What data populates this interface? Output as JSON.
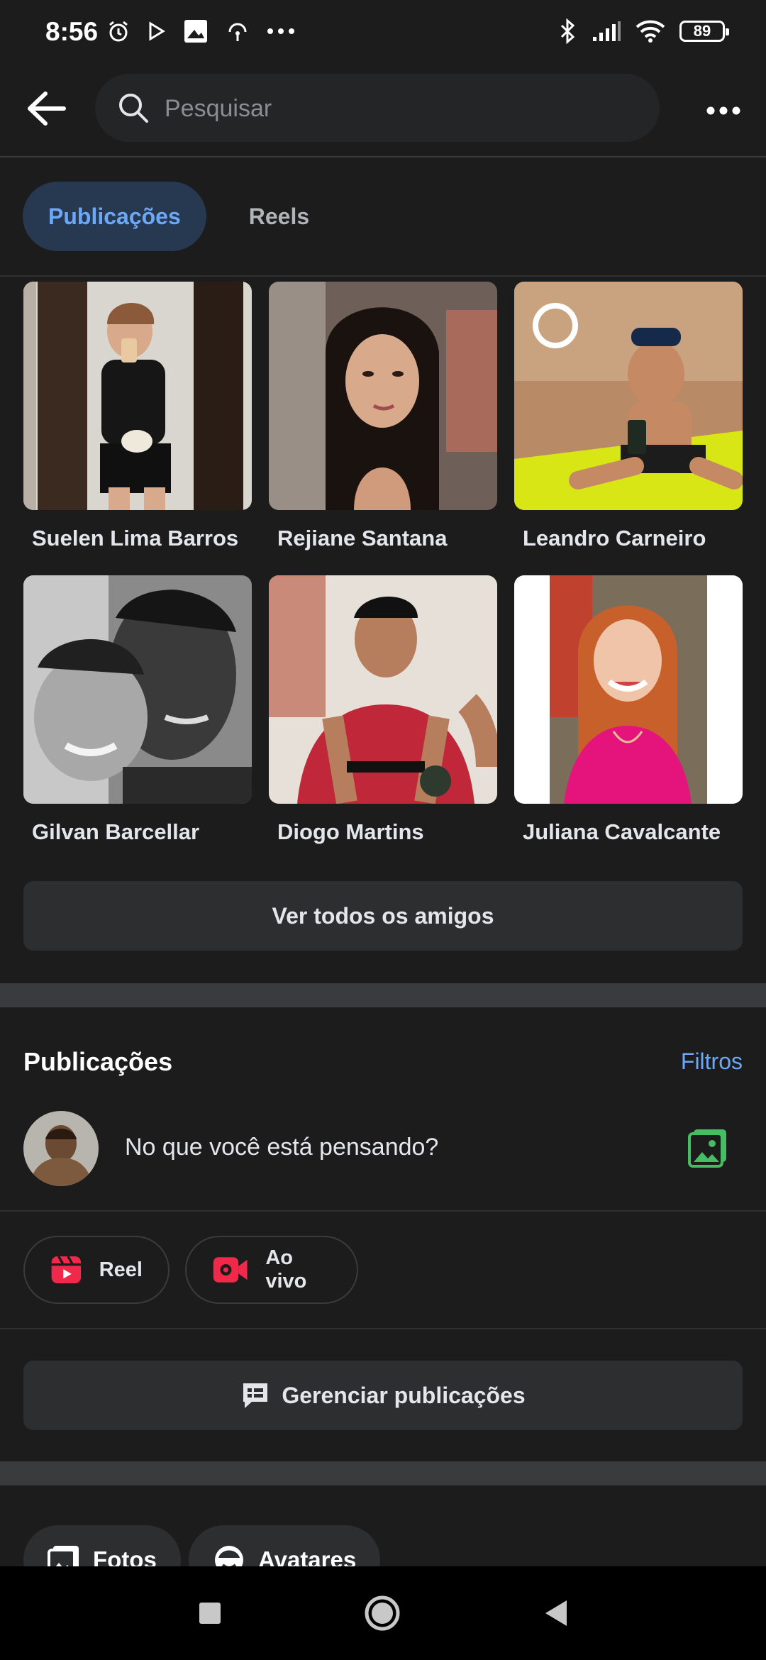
{
  "status_bar": {
    "time": "8:56",
    "battery": "89"
  },
  "search": {
    "placeholder": "Pesquisar"
  },
  "tabs": [
    {
      "label": "Publicações",
      "active": true
    },
    {
      "label": "Reels",
      "active": false
    }
  ],
  "friends": [
    {
      "name": "Suelen Lima Barros"
    },
    {
      "name": "Rejiane Santana"
    },
    {
      "name": "Leandro Carneiro"
    },
    {
      "name": "Gilvan Barcellar"
    },
    {
      "name": "Diogo Martins"
    },
    {
      "name": "Juliana Cavalcante"
    }
  ],
  "see_all_friends": "Ver todos os amigos",
  "posts_section": {
    "title": "Publicações",
    "filters": "Filtros",
    "composer_prompt": "No que você está pensando?",
    "reel_label": "Reel",
    "live_label": "Ao vivo",
    "manage_posts": "Gerenciar publicações"
  },
  "media_chips": {
    "photos": "Fotos",
    "avatars": "Avatares"
  },
  "colors": {
    "accent": "#6da8f8",
    "reel_red": "#f02849",
    "photo_green": "#45bd62",
    "background": "#1c1c1d"
  }
}
